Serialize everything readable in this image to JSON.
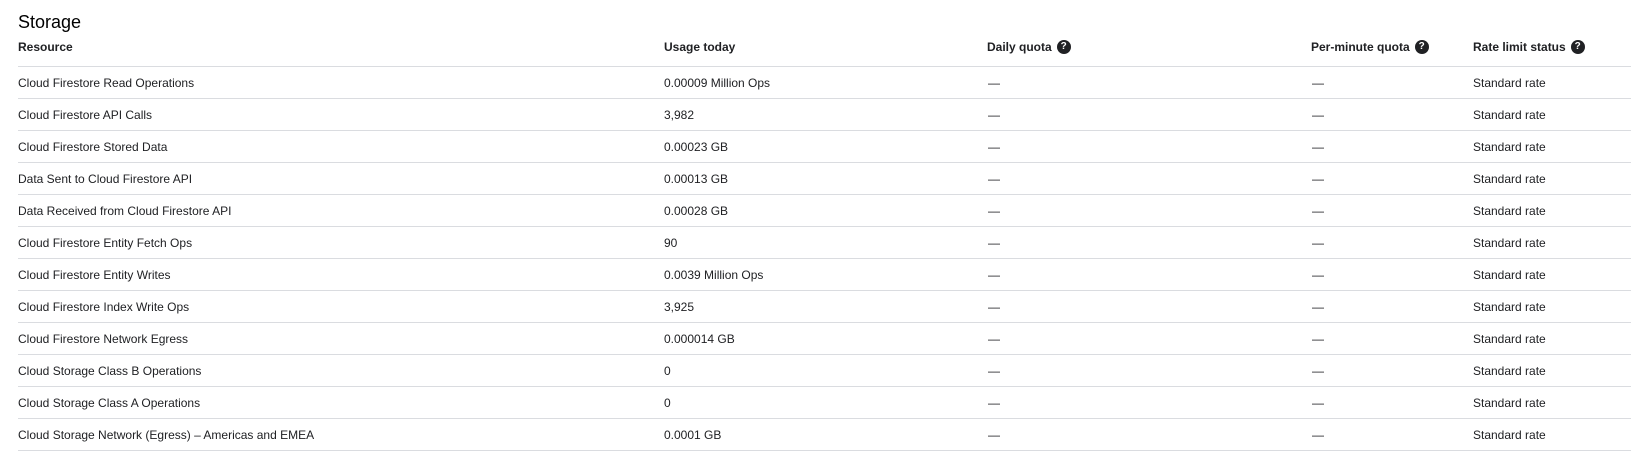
{
  "section": {
    "title": "Storage"
  },
  "table": {
    "headers": {
      "resource": "Resource",
      "usage": "Usage today",
      "daily_quota": "Daily quota",
      "per_minute_quota": "Per-minute quota",
      "rate_limit_status": "Rate limit status"
    },
    "help_icon": "question-mark-icon",
    "rows": [
      {
        "resource": "Cloud Firestore Read Operations",
        "usage": "0.00009 Million Ops",
        "daily_quota": "—",
        "per_minute_quota": "—",
        "rate_limit_status": "Standard rate"
      },
      {
        "resource": "Cloud Firestore API Calls",
        "usage": "3,982",
        "daily_quota": "—",
        "per_minute_quota": "—",
        "rate_limit_status": "Standard rate"
      },
      {
        "resource": "Cloud Firestore Stored Data",
        "usage": "0.00023 GB",
        "daily_quota": "—",
        "per_minute_quota": "—",
        "rate_limit_status": "Standard rate"
      },
      {
        "resource": "Data Sent to Cloud Firestore API",
        "usage": "0.00013 GB",
        "daily_quota": "—",
        "per_minute_quota": "—",
        "rate_limit_status": "Standard rate"
      },
      {
        "resource": "Data Received from Cloud Firestore API",
        "usage": "0.00028 GB",
        "daily_quota": "—",
        "per_minute_quota": "—",
        "rate_limit_status": "Standard rate"
      },
      {
        "resource": "Cloud Firestore Entity Fetch Ops",
        "usage": "90",
        "daily_quota": "—",
        "per_minute_quota": "—",
        "rate_limit_status": "Standard rate"
      },
      {
        "resource": "Cloud Firestore Entity Writes",
        "usage": "0.0039 Million Ops",
        "daily_quota": "—",
        "per_minute_quota": "—",
        "rate_limit_status": "Standard rate"
      },
      {
        "resource": "Cloud Firestore Index Write Ops",
        "usage": "3,925",
        "daily_quota": "—",
        "per_minute_quota": "—",
        "rate_limit_status": "Standard rate"
      },
      {
        "resource": "Cloud Firestore Network Egress",
        "usage": "0.000014 GB",
        "daily_quota": "—",
        "per_minute_quota": "—",
        "rate_limit_status": "Standard rate"
      },
      {
        "resource": "Cloud Storage Class B Operations",
        "usage": "0",
        "daily_quota": "—",
        "per_minute_quota": "—",
        "rate_limit_status": "Standard rate"
      },
      {
        "resource": "Cloud Storage Class A Operations",
        "usage": "0",
        "daily_quota": "—",
        "per_minute_quota": "—",
        "rate_limit_status": "Standard rate"
      },
      {
        "resource": "Cloud Storage Network (Egress) – Americas and EMEA",
        "usage": "0.0001 GB",
        "daily_quota": "—",
        "per_minute_quota": "—",
        "rate_limit_status": "Standard rate"
      }
    ]
  }
}
